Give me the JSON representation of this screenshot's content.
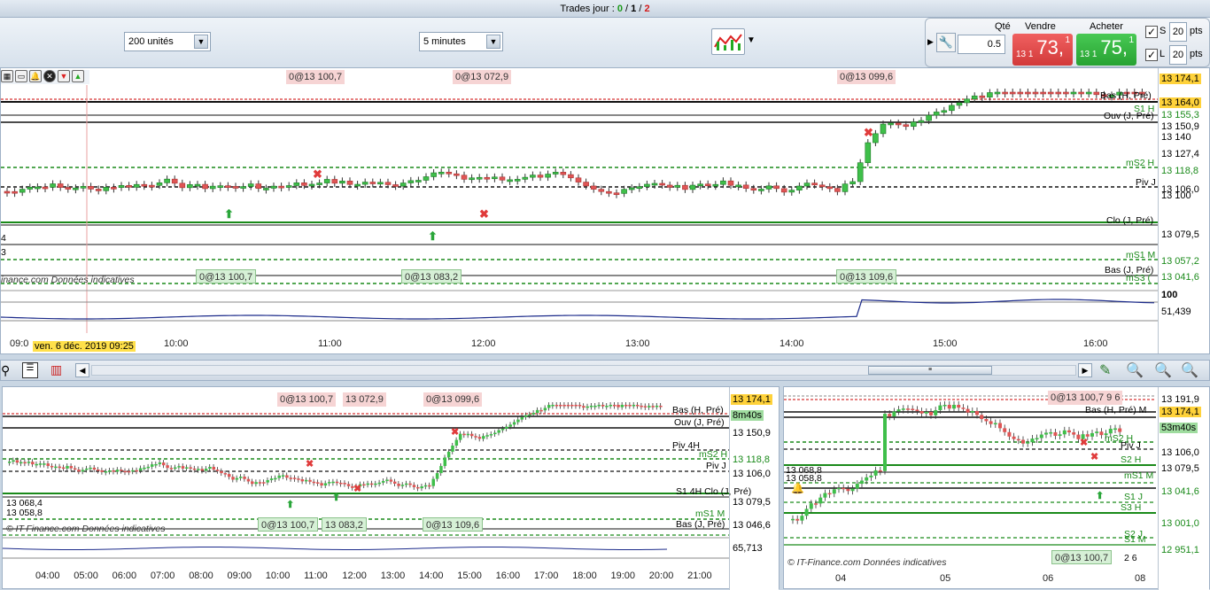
{
  "title_bar": {
    "label": "Trades jour :",
    "zero": "0",
    "one": "1",
    "two": "2",
    "sep": "/"
  },
  "toolbar": {
    "units": "200 unités",
    "interval": "5 minutes"
  },
  "trade": {
    "qty_label": "Qté",
    "qty_value": "0.5",
    "sell_label": "Vendre",
    "sell_prefix": "13 1",
    "sell_big": "73,",
    "sell_sup": "1",
    "buy_label": "Acheter",
    "buy_prefix": "13 1",
    "buy_big": "75,",
    "buy_sup": "1",
    "s_label": "S",
    "s_value": "20",
    "s_unit": "pts",
    "l_label": "L",
    "l_value": "20",
    "l_unit": "pts"
  },
  "main_chart": {
    "top_tags": [
      "0@13 100,7",
      "0@13 072,9",
      "0@13 099,6"
    ],
    "bottom_tags": [
      "0@13 100,7",
      "0@13 083,2",
      "0@13 109,6"
    ],
    "pivot_labels": {
      "bas_hpre": "Bas (H, Pré)",
      "s1h": "S1 H",
      "ouv": "Ouv (J, Pré)",
      "ms2h": "mS2 H",
      "pivj": "Piv J",
      "clo": "Clo (J, Pré)",
      "ms1m": "mS1 M",
      "basj": "Bas (J, Pré)",
      "ms3": "mS3 ("
    },
    "price_axis": [
      "13 174,1",
      "13 164,0",
      "13 155,3",
      "13 150,9",
      "13 140",
      "13 127,4",
      "13 118,8",
      "13 106,0",
      "13 100",
      "13 079,5",
      "13 057,2",
      "13 041,6"
    ],
    "watermark": "inance.com  Données indicatives",
    "osc_value": "51,439",
    "osc_top": "100",
    "time_ticks": [
      "09:0",
      "10:00",
      "11:00",
      "12:00",
      "13:00",
      "14:00",
      "15:00",
      "16:00"
    ],
    "crosshair_date": "ven. 6 déc. 2019 09:25",
    "left_edge_labels": [
      "4",
      "3"
    ]
  },
  "bottom_left": {
    "top_tags": [
      "0@13 100,7",
      "13 072,9",
      "0@13 099,6"
    ],
    "bottom_tags": [
      "0@13 100,7",
      "13 083,2",
      "0@13 109,6"
    ],
    "price_axis": [
      "13 174,1",
      "8m40s",
      "13 150,9",
      "13 118,8",
      "13 106,0",
      "13 079,5",
      "13 046,6"
    ],
    "pivots": {
      "bas": "Bas (H, Pré)",
      "ouv": "Ouv (J, Pré)",
      "piv4h": "Piv 4H",
      "ms2h": "mS2 H",
      "pivj": "Piv J",
      "clo": "S1 4H Clo (J, Pré)",
      "ms1m": "mS1 M",
      "basj": "Bas (J, Pré)"
    },
    "left_labels": [
      "13 068,4",
      "13 058,8"
    ],
    "watermark": "© IT-Finance.com  Données indicatives",
    "osc_value": "65,713",
    "time_ticks": [
      "04:00",
      "05:00",
      "06:00",
      "07:00",
      "08:00",
      "09:00",
      "10:00",
      "11:00",
      "12:00",
      "13:00",
      "14:00",
      "15:00",
      "16:00",
      "17:00",
      "18:00",
      "19:00",
      "20:00",
      "21:00"
    ]
  },
  "bottom_right": {
    "top_tag": "0@13 100,7 9 6",
    "bottom_tag": "0@13 100,7",
    "bottom_tag_extra": "2 6",
    "price_axis": [
      "13 191,9",
      "13 174,1",
      "53m40s",
      "13 106,0",
      "13 079,5",
      "13 041,6",
      "13 001,0",
      "12 951,1"
    ],
    "pivots": {
      "basm": "Bas (H, Pré) M",
      "pivj": "Piv J",
      "s2h": "S2 H",
      "ms1m": "mS1 M",
      "s1j": "S1 J",
      "s3h": "S3 H",
      "s2j": "S2 J",
      "s1m": "S1 M",
      "ms2h": "mS2 H"
    },
    "left_labels": [
      "13 068,8",
      "13 058,8"
    ],
    "watermark": "© IT-Finance.com  Données indicatives",
    "time_ticks": [
      "04",
      "05",
      "06",
      "08"
    ]
  },
  "colors": {
    "up": "#3fbf4a",
    "down": "#e05555",
    "sell": "#e04a4a",
    "buy": "#2fae3b",
    "level_green": "#1a8a1a"
  }
}
